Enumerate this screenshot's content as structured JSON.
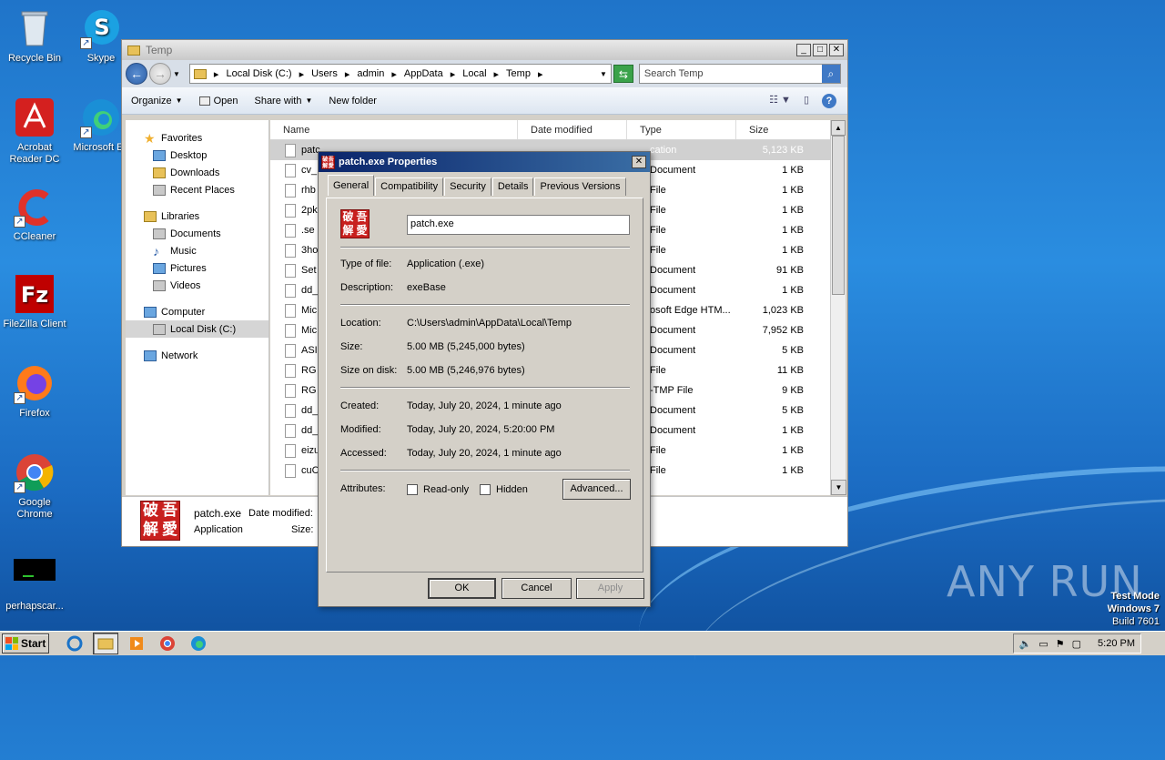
{
  "desktop": {
    "icons": [
      {
        "label": "Recycle Bin",
        "icon": "recycle-bin-icon"
      },
      {
        "label": "Skype",
        "icon": "skype-icon"
      },
      {
        "label": "Acrobat Reader DC",
        "icon": "acrobat-icon"
      },
      {
        "label": "Microsoft Ed",
        "icon": "edge-icon"
      },
      {
        "label": "CCleaner",
        "icon": "ccleaner-icon"
      },
      {
        "label": "FileZilla Client",
        "icon": "filezilla-icon"
      },
      {
        "label": "Firefox",
        "icon": "firefox-icon"
      },
      {
        "label": "Google Chrome",
        "icon": "chrome-icon"
      },
      {
        "label": "perhapscar...",
        "icon": "console-icon"
      }
    ],
    "watermark": "ANY RUN",
    "test_mode": {
      "line1": "Test Mode",
      "line2": "Windows 7",
      "line3": "Build 7601"
    }
  },
  "explorer": {
    "title": "Temp",
    "breadcrumb": [
      "Local Disk (C:)",
      "Users",
      "admin",
      "AppData",
      "Local",
      "Temp"
    ],
    "search_placeholder": "Search Temp",
    "toolbar": {
      "organize": "Organize",
      "open": "Open",
      "share_with": "Share with",
      "new_folder": "New folder"
    },
    "nav": {
      "favorites": "Favorites",
      "desktop": "Desktop",
      "downloads": "Downloads",
      "recent": "Recent Places",
      "libraries": "Libraries",
      "documents": "Documents",
      "music": "Music",
      "pictures": "Pictures",
      "videos": "Videos",
      "computer": "Computer",
      "local_disk": "Local Disk (C:)",
      "network": "Network"
    },
    "columns": {
      "name": "Name",
      "date": "Date modified",
      "type": "Type",
      "size": "Size"
    },
    "files": [
      {
        "name": "patc",
        "type": "cation",
        "size": "5,123 KB"
      },
      {
        "name": "cv_",
        "type": "Document",
        "size": "1 KB"
      },
      {
        "name": "rhb",
        "type": "File",
        "size": "1 KB"
      },
      {
        "name": "2pk",
        "type": "File",
        "size": "1 KB"
      },
      {
        "name": ".se",
        "type": "File",
        "size": "1 KB"
      },
      {
        "name": "3ho",
        "type": "File",
        "size": "1 KB"
      },
      {
        "name": "Set",
        "type": "Document",
        "size": "91 KB"
      },
      {
        "name": "dd_",
        "type": "Document",
        "size": "1 KB"
      },
      {
        "name": "Mic",
        "type": "osoft Edge HTM...",
        "size": "1,023 KB"
      },
      {
        "name": "Mic",
        "type": "Document",
        "size": "7,952 KB"
      },
      {
        "name": "ASI",
        "type": "Document",
        "size": "5 KB"
      },
      {
        "name": "RG",
        "type": "File",
        "size": "11 KB"
      },
      {
        "name": "RG",
        "type": "-TMP File",
        "size": "9 KB"
      },
      {
        "name": "dd_",
        "type": "Document",
        "size": "5 KB"
      },
      {
        "name": "dd_",
        "type": "Document",
        "size": "1 KB"
      },
      {
        "name": "eizu",
        "type": "File",
        "size": "1 KB"
      },
      {
        "name": "cuC",
        "type": "File",
        "size": "1 KB"
      }
    ],
    "details": {
      "filename": "patch.exe",
      "date_label": "Date modified:",
      "type": "Application",
      "size_label": "Size:"
    }
  },
  "properties": {
    "title": "patch.exe Properties",
    "tabs": [
      "General",
      "Compatibility",
      "Security",
      "Details",
      "Previous Versions"
    ],
    "file_name": "patch.exe",
    "type_label": "Type of file:",
    "type_value": "Application (.exe)",
    "desc_label": "Description:",
    "desc_value": "exeBase",
    "location_label": "Location:",
    "location_value": "C:\\Users\\admin\\AppData\\Local\\Temp",
    "size_label": "Size:",
    "size_value": "5.00 MB (5,245,000 bytes)",
    "sizeondisk_label": "Size on disk:",
    "sizeondisk_value": "5.00 MB (5,246,976 bytes)",
    "created_label": "Created:",
    "created_value": "Today, July 20, 2024, 1 minute ago",
    "modified_label": "Modified:",
    "modified_value": "Today, July 20, 2024, 5:20:00 PM",
    "accessed_label": "Accessed:",
    "accessed_value": "Today, July 20, 2024, 1 minute ago",
    "attributes_label": "Attributes:",
    "readonly_label": "Read-only",
    "hidden_label": "Hidden",
    "advanced_label": "Advanced...",
    "ok": "OK",
    "cancel": "Cancel",
    "apply": "Apply",
    "seal_chars": [
      "吾",
      "愛",
      "破",
      "解"
    ]
  },
  "taskbar": {
    "start": "Start",
    "time": "5:20 PM"
  }
}
